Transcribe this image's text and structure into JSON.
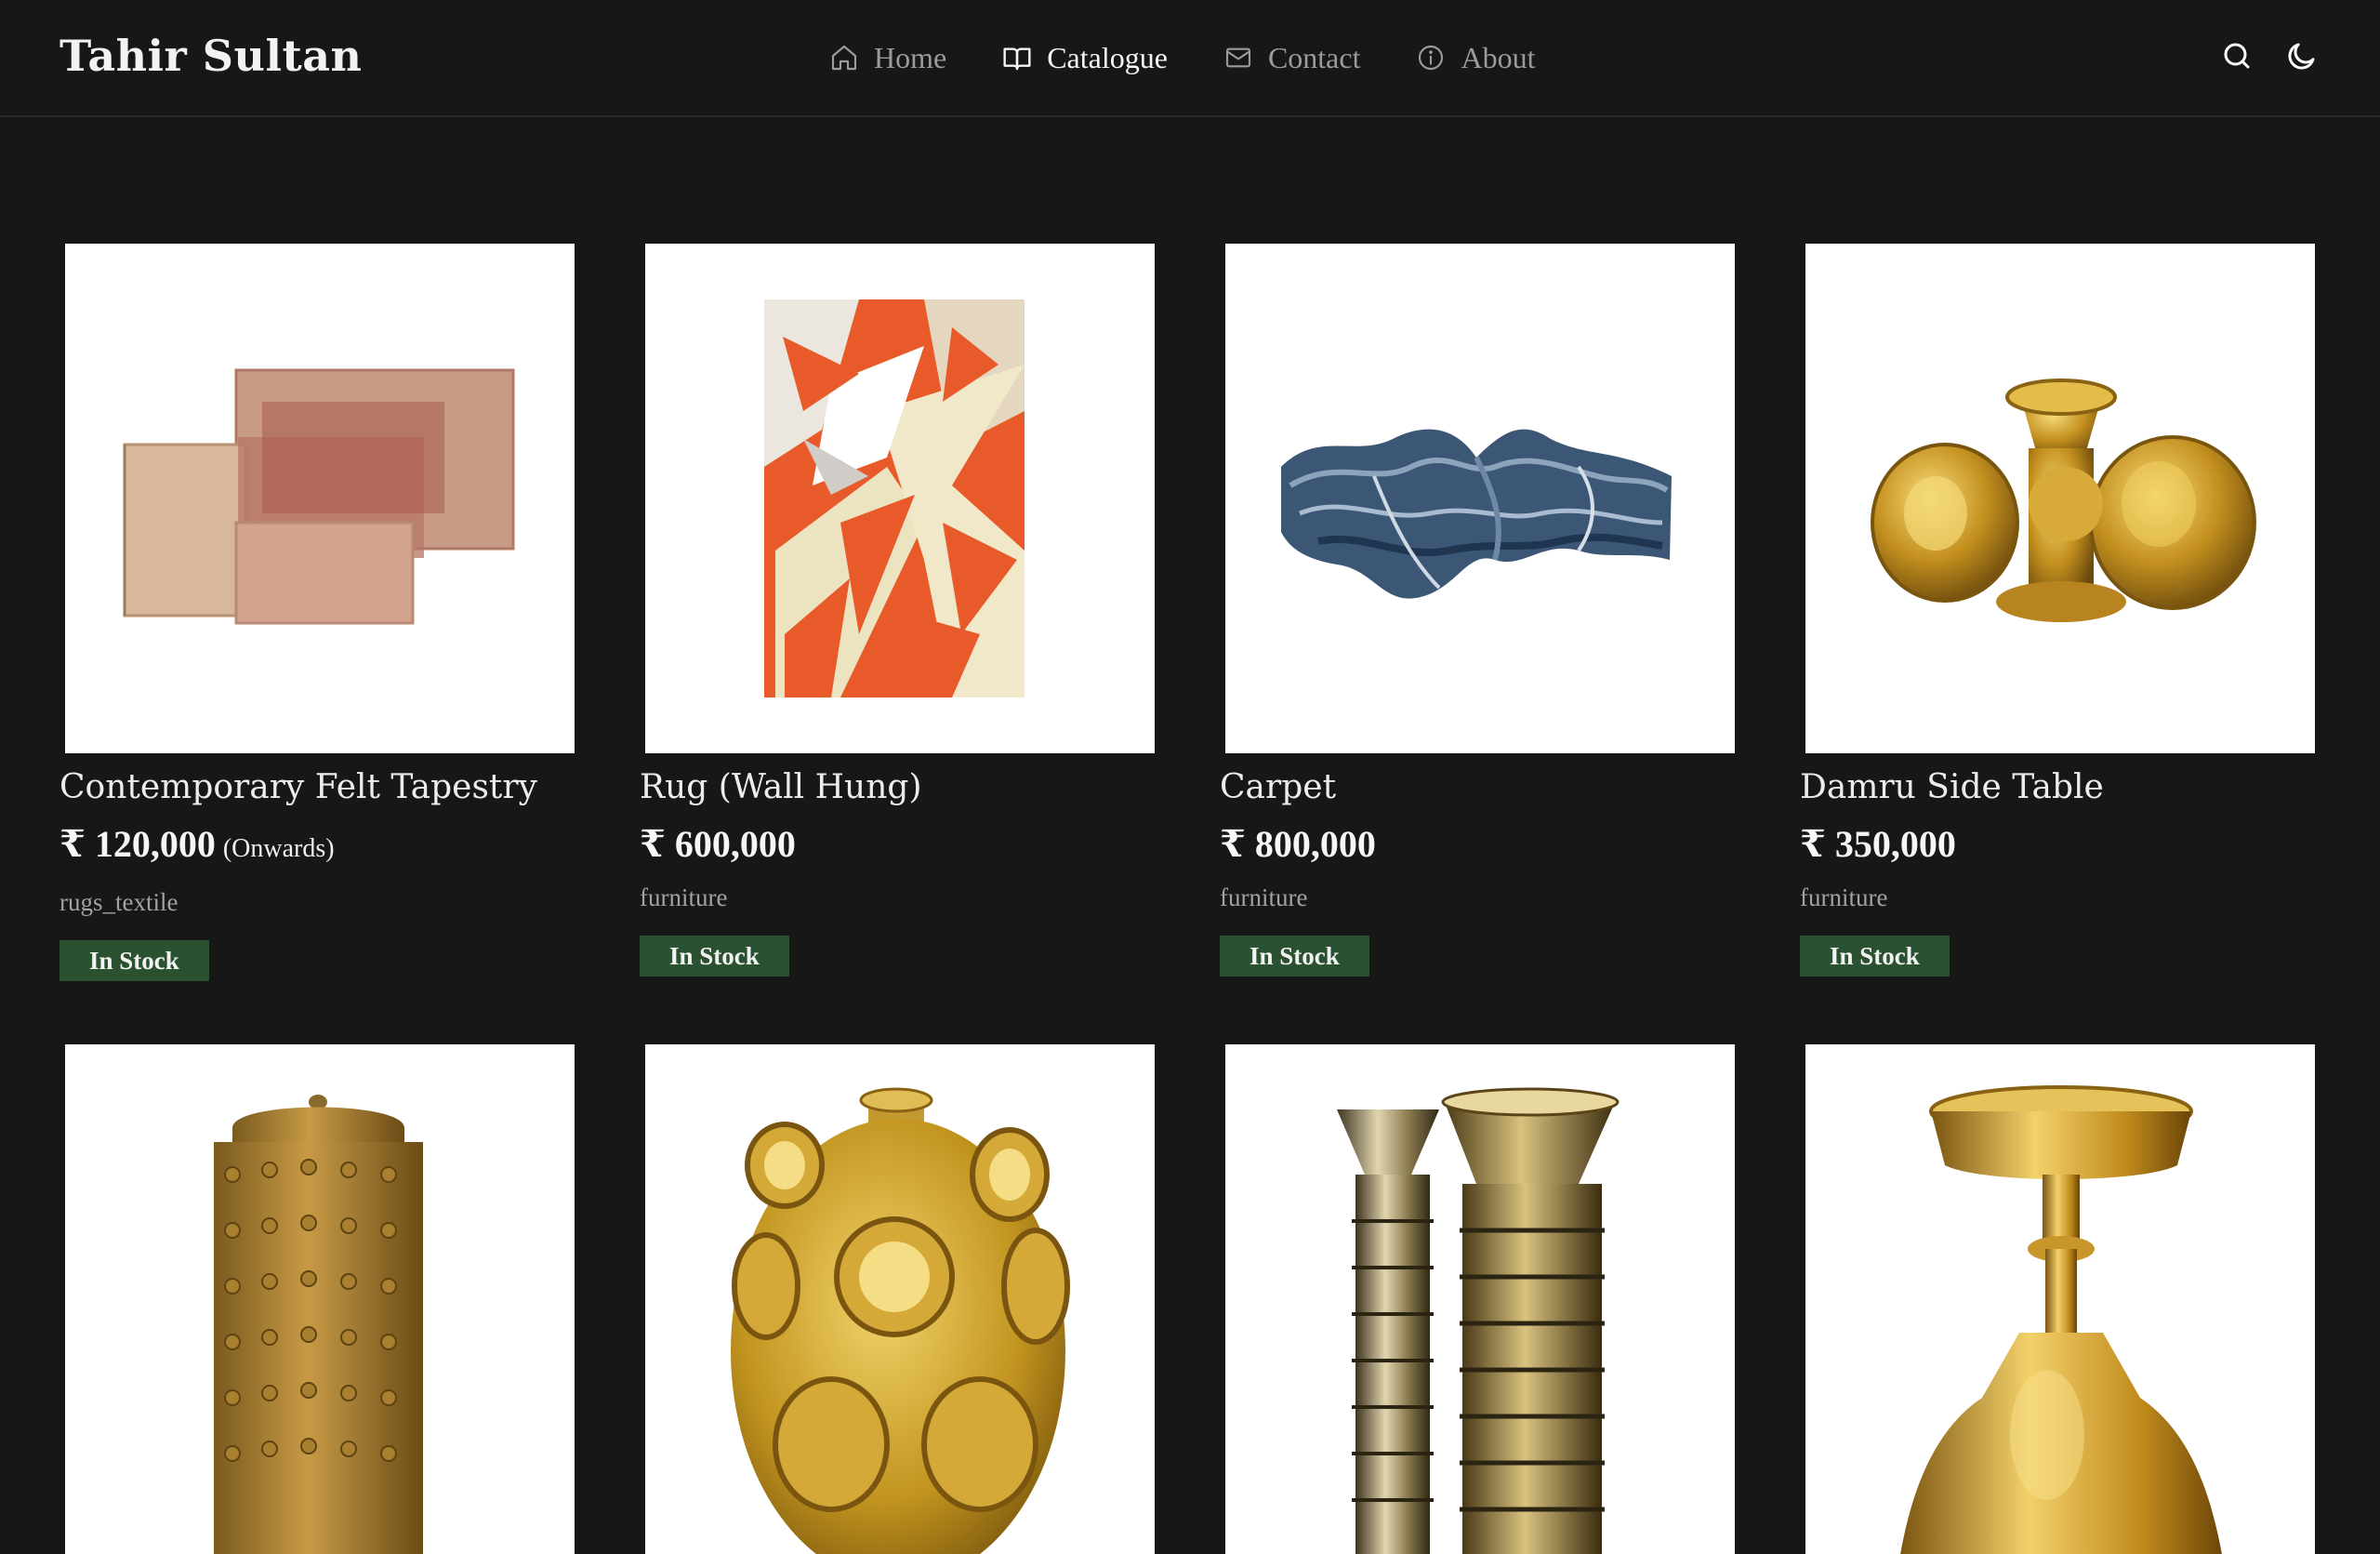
{
  "header": {
    "brand": "Tahir Sultan",
    "nav": [
      {
        "label": "Home",
        "icon": "home-icon",
        "active": false
      },
      {
        "label": "Catalogue",
        "icon": "book-icon",
        "active": true
      },
      {
        "label": "Contact",
        "icon": "mail-icon",
        "active": false
      },
      {
        "label": "About",
        "icon": "info-icon",
        "active": false
      }
    ],
    "tools": [
      {
        "icon": "search-icon"
      },
      {
        "icon": "moon-icon"
      }
    ]
  },
  "products": [
    {
      "title": "Contemporary Felt Tapestry",
      "price": "₹ 120,000",
      "price_note": "(Onwards)",
      "category": "rugs_textile",
      "status": "In Stock",
      "image": "felt-tapestry-image"
    },
    {
      "title": "Rug (Wall Hung)",
      "price": "₹ 600,000",
      "price_note": "",
      "category": "furniture",
      "status": "In Stock",
      "image": "wall-rug-image"
    },
    {
      "title": "Carpet",
      "price": "₹ 800,000",
      "price_note": "",
      "category": "furniture",
      "status": "In Stock",
      "image": "carpet-image"
    },
    {
      "title": "Damru Side Table",
      "price": "₹ 350,000",
      "price_note": "",
      "category": "furniture",
      "status": "In Stock",
      "image": "damru-table-image"
    },
    {
      "image": "studded-brass-cylinder-image"
    },
    {
      "image": "brass-ring-vase-image"
    },
    {
      "image": "brass-stacked-candlesticks-image"
    },
    {
      "image": "brass-goblet-stand-image"
    }
  ],
  "colors": {
    "background": "#171717",
    "badge": "#2a5230",
    "text": "#e8e8e8",
    "muted": "#a2a2a2"
  }
}
